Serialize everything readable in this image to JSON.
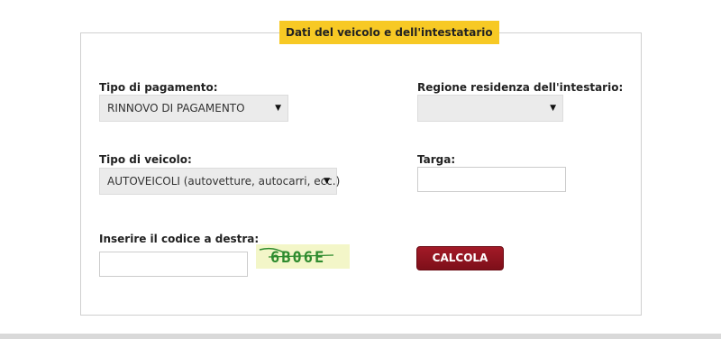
{
  "form": {
    "legend": "Dati del veicolo e dell'intestatario",
    "payment_type": {
      "label": "Tipo di pagamento:",
      "value": "RINNOVO DI PAGAMENTO"
    },
    "region": {
      "label": "Regione residenza dell'intestario:",
      "value": ""
    },
    "vehicle_type": {
      "label": "Tipo di veicolo:",
      "value": "AUTOVEICOLI (autovetture, autocarri, ecc.)"
    },
    "plate": {
      "label": "Targa:",
      "value": ""
    },
    "captcha": {
      "label": "Inserire il codice a destra:",
      "value": "",
      "code": "6B06E"
    },
    "submit_label": "CALCOLA"
  },
  "icons": {
    "dropdown": "triangle-down-icon"
  },
  "colors": {
    "legend_bg": "#f7c924",
    "button": "#8e1420",
    "captcha_text": "#2e8b2e"
  }
}
